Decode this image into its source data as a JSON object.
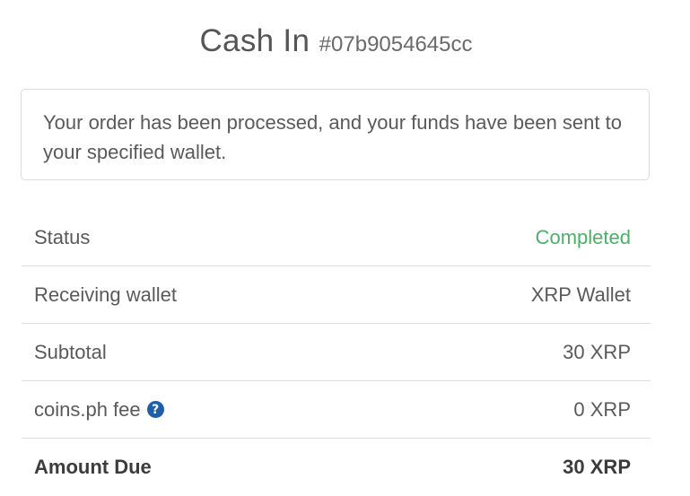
{
  "header": {
    "title": "Cash In",
    "order_ref": "#07b9054645cc"
  },
  "notice": {
    "message": "Your order has been processed, and your funds have been sent to your specified wallet."
  },
  "details": [
    {
      "label": "Status",
      "value": "Completed"
    },
    {
      "label": "Receiving wallet",
      "value": "XRP Wallet"
    },
    {
      "label": "Subtotal",
      "value": "30 XRP"
    },
    {
      "label": "coins.ph fee",
      "value": "0 XRP"
    },
    {
      "label": "Amount Due",
      "value": "30 XRP"
    }
  ],
  "icons": {
    "fee_help": "question-circle-icon"
  },
  "colors": {
    "status_completed": "#4caf6a",
    "help_icon": "#1f5fa8"
  }
}
